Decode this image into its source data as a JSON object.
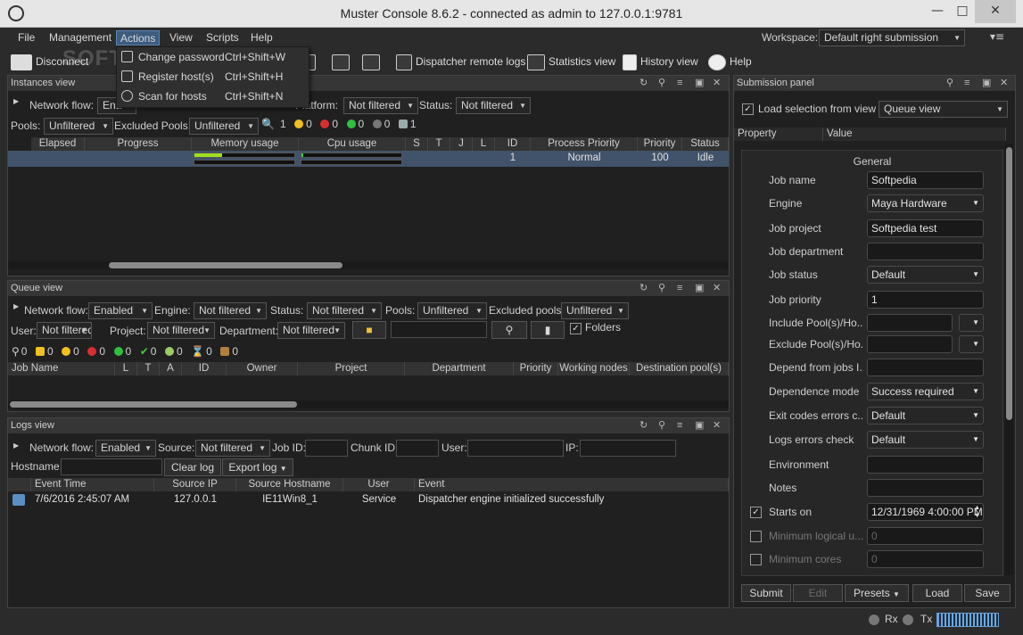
{
  "window": {
    "title": "Muster Console 8.6.2 - connected as admin to 127.0.0.1:9781"
  },
  "menu": {
    "items": [
      "File",
      "Management",
      "Actions",
      "View",
      "Scripts",
      "Help"
    ],
    "active": "Actions"
  },
  "actions_menu": [
    {
      "label": "Change password",
      "shortcut": "Ctrl+Shift+W",
      "icon": "key-icon"
    },
    {
      "label": "Register host(s)",
      "shortcut": "Ctrl+Shift+H",
      "icon": "register-host-icon"
    },
    {
      "label": "Scan for hosts",
      "shortcut": "Ctrl+Shift+N",
      "icon": "scan-icon"
    }
  ],
  "workspace": {
    "label": "Workspace:",
    "value": "Default right submission"
  },
  "toolbar": {
    "disconnect": "Disconnect",
    "dispatcher_logs": "Dispatcher remote logs",
    "statistics": "Statistics view",
    "history": "History view",
    "help": "Help"
  },
  "watermark": "SOFTPEDIA",
  "instances": {
    "title": "Instances view",
    "network_flow_label": "Network flow:",
    "network_flow_value": "Ena",
    "platform_label": "Platform:",
    "platform_value": "Not filtered",
    "status_label": "Status:",
    "status_value": "Not filtered",
    "pools_label": "Pools:",
    "pools_value": "Unfiltered",
    "excluded_pools_label": "Excluded Pools:",
    "excluded_pools_value": "Unfiltered",
    "counts": [
      "1",
      "0",
      "0",
      "0",
      "0",
      "1"
    ],
    "columns": [
      "Elapsed",
      "Progress",
      "Memory usage",
      "Cpu usage",
      "S",
      "T",
      "J",
      "L",
      "ID",
      "Process Priority",
      "Priority",
      "Status"
    ],
    "row": {
      "id": "1",
      "process_priority": "Normal",
      "priority": "100",
      "status": "Idle",
      "memory_fraction": 0.28,
      "cpu_fraction": 0.02
    }
  },
  "queue": {
    "title": "Queue view",
    "network_flow_label": "Network flow:",
    "network_flow_value": "Enabled",
    "engine_label": "Engine:",
    "engine_value": "Not filtered",
    "status_label": "Status:",
    "status_value": "Not filtered",
    "pools_label": "Pools:",
    "pools_value": "Unfiltered",
    "excluded_pools_label": "Excluded pools:",
    "excluded_pools_value": "Unfiltered",
    "user_label": "User:",
    "user_value": "Not filtered",
    "project_label": "Project:",
    "project_value": "Not filtered",
    "department_label": "Department:",
    "department_value": "Not filtered",
    "folders_label": "Folders",
    "counts": [
      "0",
      "0",
      "0",
      "0",
      "0",
      "0",
      "0",
      "0",
      "0"
    ],
    "columns": [
      "Job Name",
      "L",
      "T",
      "A",
      "ID",
      "Owner",
      "Project",
      "Department",
      "Priority",
      "Working nodes",
      "Destination pool(s)"
    ]
  },
  "logs": {
    "title": "Logs view",
    "network_flow_label": "Network flow:",
    "network_flow_value": "Enabled",
    "source_label": "Source:",
    "source_value": "Not filtered",
    "job_id_label": "Job ID:",
    "chunk_id_label": "Chunk ID:",
    "user_label": "User:",
    "ip_label": "IP:",
    "hostname_label": "Hostname:",
    "clear_log": "Clear log",
    "export_log": "Export log",
    "columns": [
      "Event Time",
      "Source IP",
      "Source Hostname",
      "User",
      "Event"
    ],
    "rows": [
      {
        "time": "7/6/2016 2:45:07 AM",
        "ip": "127.0.0.1",
        "hostname": "IE11Win8_1",
        "user": "Service",
        "event": "Dispatcher engine initialized successfully"
      }
    ]
  },
  "submission": {
    "title": "Submission panel",
    "load_selection_label": "Load selection from view",
    "load_selection_value": "Queue view",
    "col_property": "Property",
    "col_value": "Value",
    "group": "General",
    "properties": [
      {
        "label": "Job name",
        "value": "Softpedia",
        "kind": "text"
      },
      {
        "label": "Engine",
        "value": "Maya Hardware",
        "kind": "combo"
      },
      {
        "label": "Job project",
        "value": "Softpedia test",
        "kind": "text"
      },
      {
        "label": "Job department",
        "value": "",
        "kind": "text"
      },
      {
        "label": "Job status",
        "value": "Default",
        "kind": "combo"
      },
      {
        "label": "Job priority",
        "value": "1",
        "kind": "text"
      },
      {
        "label": "Include Pool(s)/Ho...",
        "value": "",
        "kind": "split"
      },
      {
        "label": "Exclude Pool(s)/Ho...",
        "value": "",
        "kind": "split"
      },
      {
        "label": "Depend from jobs I...",
        "value": "",
        "kind": "text"
      },
      {
        "label": "Dependence mode",
        "value": "Success required",
        "kind": "combo"
      },
      {
        "label": "Exit codes errors c...",
        "value": "Default",
        "kind": "combo"
      },
      {
        "label": "Logs errors check",
        "value": "Default",
        "kind": "combo"
      },
      {
        "label": "Environment",
        "value": "",
        "kind": "text"
      },
      {
        "label": "Notes",
        "value": "",
        "kind": "text"
      },
      {
        "label": "Starts on",
        "value": "12/31/1969 4:00:00 PM",
        "kind": "date",
        "checked": true
      },
      {
        "label": "Minimum logical u...",
        "value": "0",
        "kind": "disabled",
        "checked": false
      },
      {
        "label": "Minimum cores",
        "value": "0",
        "kind": "disabled",
        "checked": false
      }
    ],
    "buttons": {
      "submit": "Submit",
      "edit": "Edit",
      "presets": "Presets",
      "load": "Load",
      "save": "Save"
    }
  },
  "status": {
    "rx": "Rx",
    "tx": "Tx"
  }
}
